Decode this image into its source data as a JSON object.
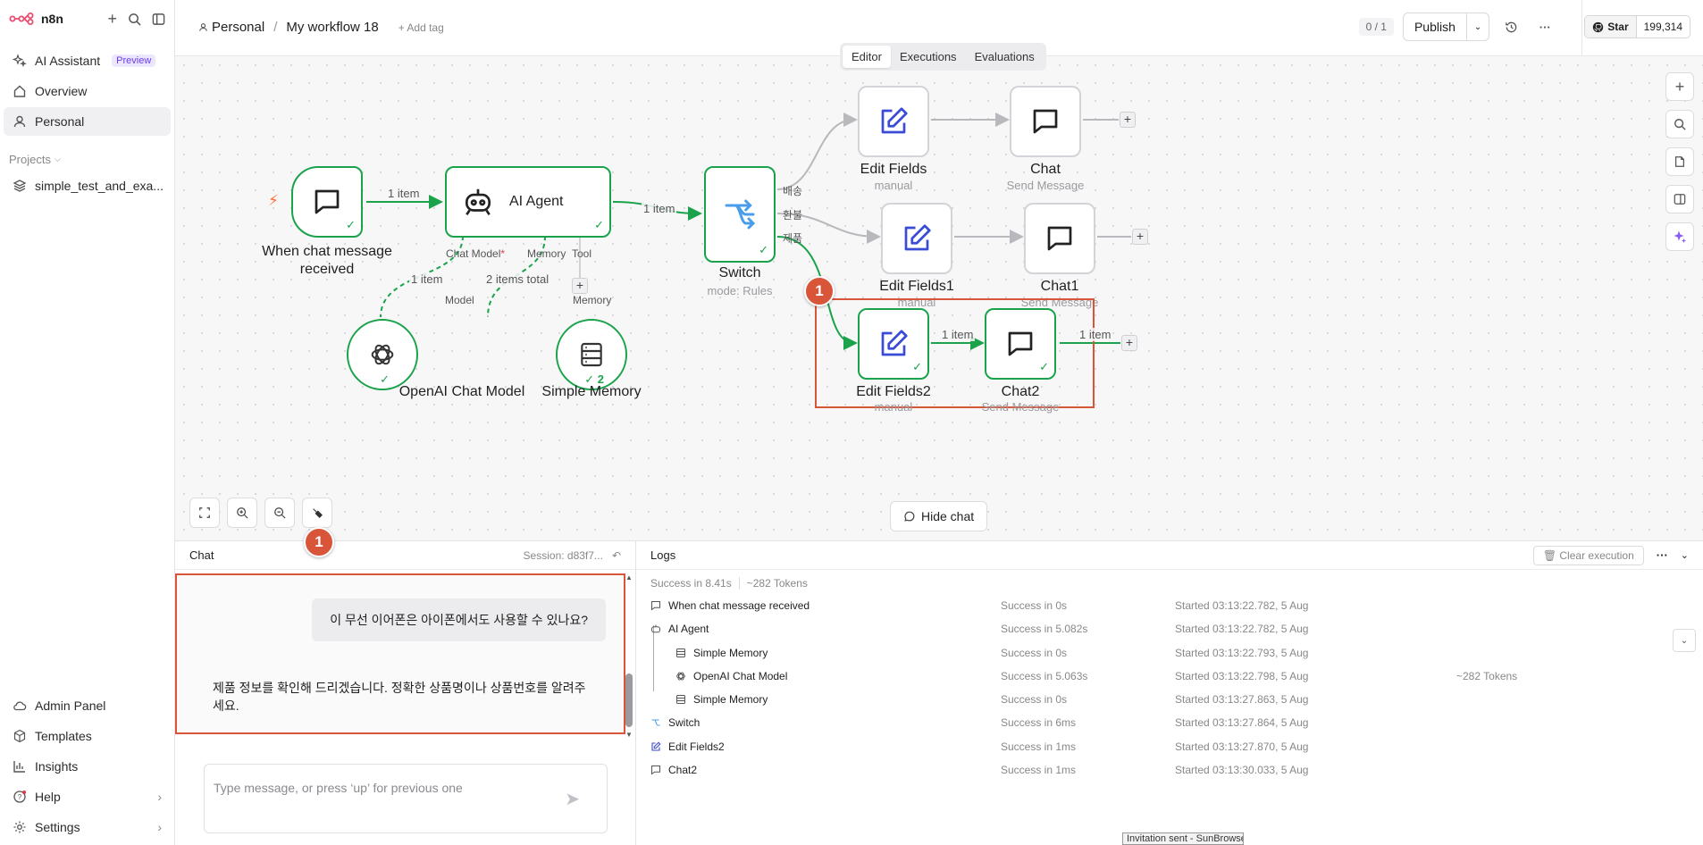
{
  "app": {
    "name": "n8n"
  },
  "sidebar": {
    "items": [
      {
        "label": "AI Assistant",
        "badge": "Preview"
      },
      {
        "label": "Overview"
      },
      {
        "label": "Personal"
      }
    ],
    "projects_label": "Projects",
    "project_item": "simple_test_and_exa...",
    "bottom": [
      {
        "label": "Admin Panel"
      },
      {
        "label": "Templates"
      },
      {
        "label": "Insights"
      },
      {
        "label": "Help"
      },
      {
        "label": "Settings"
      }
    ]
  },
  "header": {
    "breadcrumb_owner": "Personal",
    "breadcrumb_sep": "/",
    "workflow_name": "My workflow 18",
    "add_tag": "+ Add tag",
    "counter": "0 / 1",
    "publish": "Publish",
    "github_star": "Star",
    "github_count": "199,314"
  },
  "tabs": [
    "Editor",
    "Executions",
    "Evaluations"
  ],
  "canvas": {
    "nodes": {
      "trigger": {
        "label1": "When chat message",
        "label2": "received"
      },
      "agent": {
        "label": "AI Agent",
        "port_chat": "Chat Model",
        "port_req": "*",
        "port_memory": "Memory",
        "port_tool": "Tool"
      },
      "switch": {
        "label": "Switch",
        "sub": "mode: Rules",
        "out1": "배송",
        "out2": "환불",
        "out3": "제품"
      },
      "openai": {
        "label": "OpenAI Chat Model",
        "port": "Model"
      },
      "memory": {
        "label": "Simple Memory",
        "port": "Memory",
        "count": "2"
      },
      "ef": {
        "label": "Edit Fields",
        "sub": "manual"
      },
      "chat": {
        "label": "Chat",
        "sub": "Send Message"
      },
      "ef1": {
        "label": "Edit Fields1",
        "sub": "manual"
      },
      "chat1": {
        "label": "Chat1",
        "sub": "Send Message"
      },
      "ef2": {
        "label": "Edit Fields2",
        "sub": "manual"
      },
      "chat2": {
        "label": "Chat2",
        "sub": "Send Message"
      }
    },
    "edges": {
      "e1": "1 item",
      "e2": "1 item",
      "e3": "1 item",
      "e4": "2 items total",
      "e5": "1 item",
      "e6": "1 item"
    },
    "step_badge": "1",
    "hide_chat": "Hide chat"
  },
  "chat": {
    "title": "Chat",
    "session": "Session: d83f7...",
    "step_badge": "1",
    "user_msg": "이 무선 이어폰은 아이폰에서도 사용할 수 있나요?",
    "bot_msg": "제품 정보를 확인해 드리겠습니다. 정확한 상품명이나 상품번호를 알려주세요.",
    "input_placeholder": "Type message, or press ‘up’ for previous one"
  },
  "logs": {
    "title": "Logs",
    "summary_time": "Success in 8.41s",
    "summary_tokens": "~282 Tokens",
    "clear": "Clear execution",
    "rows": [
      {
        "name": "When chat message received",
        "status": "Success in 0s",
        "started": "Started 03:13:22.782, 5 Aug",
        "tokens": ""
      },
      {
        "name": "AI Agent",
        "status": "Success in 5.082s",
        "started": "Started 03:13:22.782, 5 Aug",
        "tokens": ""
      },
      {
        "name": "Simple Memory",
        "status": "Success in 0s",
        "started": "Started 03:13:22.793, 5 Aug",
        "tokens": ""
      },
      {
        "name": "OpenAI Chat Model",
        "status": "Success in 5.063s",
        "started": "Started 03:13:22.798, 5 Aug",
        "tokens": "~282 Tokens"
      },
      {
        "name": "Simple Memory",
        "status": "Success in 0s",
        "started": "Started 03:13:27.863, 5 Aug",
        "tokens": ""
      },
      {
        "name": "Switch",
        "status": "Success in 6ms",
        "started": "Started 03:13:27.864, 5 Aug",
        "tokens": ""
      },
      {
        "name": "Edit Fields2",
        "status": "Success in 1ms",
        "started": "Started 03:13:27.870, 5 Aug",
        "tokens": ""
      },
      {
        "name": "Chat2",
        "status": "Success in 1ms",
        "started": "Started 03:13:30.033, 5 Aug",
        "tokens": ""
      }
    ]
  },
  "toast": "Invitation sent - SunBrowser",
  "colors": {
    "success": "#1ba34b",
    "accent": "#d9553a",
    "trigger": "#ff6d3a",
    "brand": "#ea4b71"
  }
}
